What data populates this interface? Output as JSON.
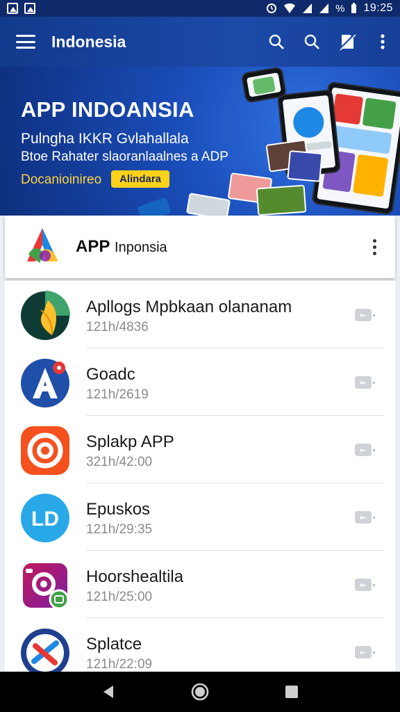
{
  "status_bar": {
    "time": "19:25",
    "left_icons": [
      "image-icon",
      "image-icon"
    ],
    "right_icons": [
      "alarm-icon",
      "wifi-icon",
      "signal-icon",
      "signal-icon",
      "percent-icon"
    ]
  },
  "app_bar": {
    "title": "Indonesia",
    "icons": [
      "search-icon",
      "search-icon",
      "no-sim-icon",
      "more-vert-icon"
    ]
  },
  "banner": {
    "title": "APP INDOANSIA",
    "subtitle_1": "Pulngha IKKR Gvlahallala",
    "subtitle_2": "Btoe Rahater slaoranlaalnes a ADP",
    "promo_text": "Docanioinireo",
    "badge": "Alindara"
  },
  "card_header": {
    "title_bold": "APP",
    "title_rest": "Inponsia"
  },
  "list": {
    "items": [
      {
        "name": "Apllogs Mpbkaan olananam",
        "meta": "121h/4836",
        "icon": "app-icon-leaf"
      },
      {
        "name": "Goadc",
        "meta": "121h/2619",
        "icon": "app-icon-a"
      },
      {
        "name": "Splakp APP",
        "meta": "321h/42:00",
        "icon": "app-icon-target"
      },
      {
        "name": "Epuskos",
        "meta": "121h/29:35",
        "icon": "app-icon-ld"
      },
      {
        "name": "Hoorshealtila",
        "meta": "121h/25:00",
        "icon": "app-icon-camera"
      },
      {
        "name": "Splatce",
        "meta": "121h/22:09",
        "icon": "app-icon-x"
      }
    ]
  },
  "colors": {
    "app_bar": "#1b4aa8",
    "status_bar": "#0f2a6b",
    "badge": "#ffd21a",
    "promo_text": "#ffd23f"
  }
}
